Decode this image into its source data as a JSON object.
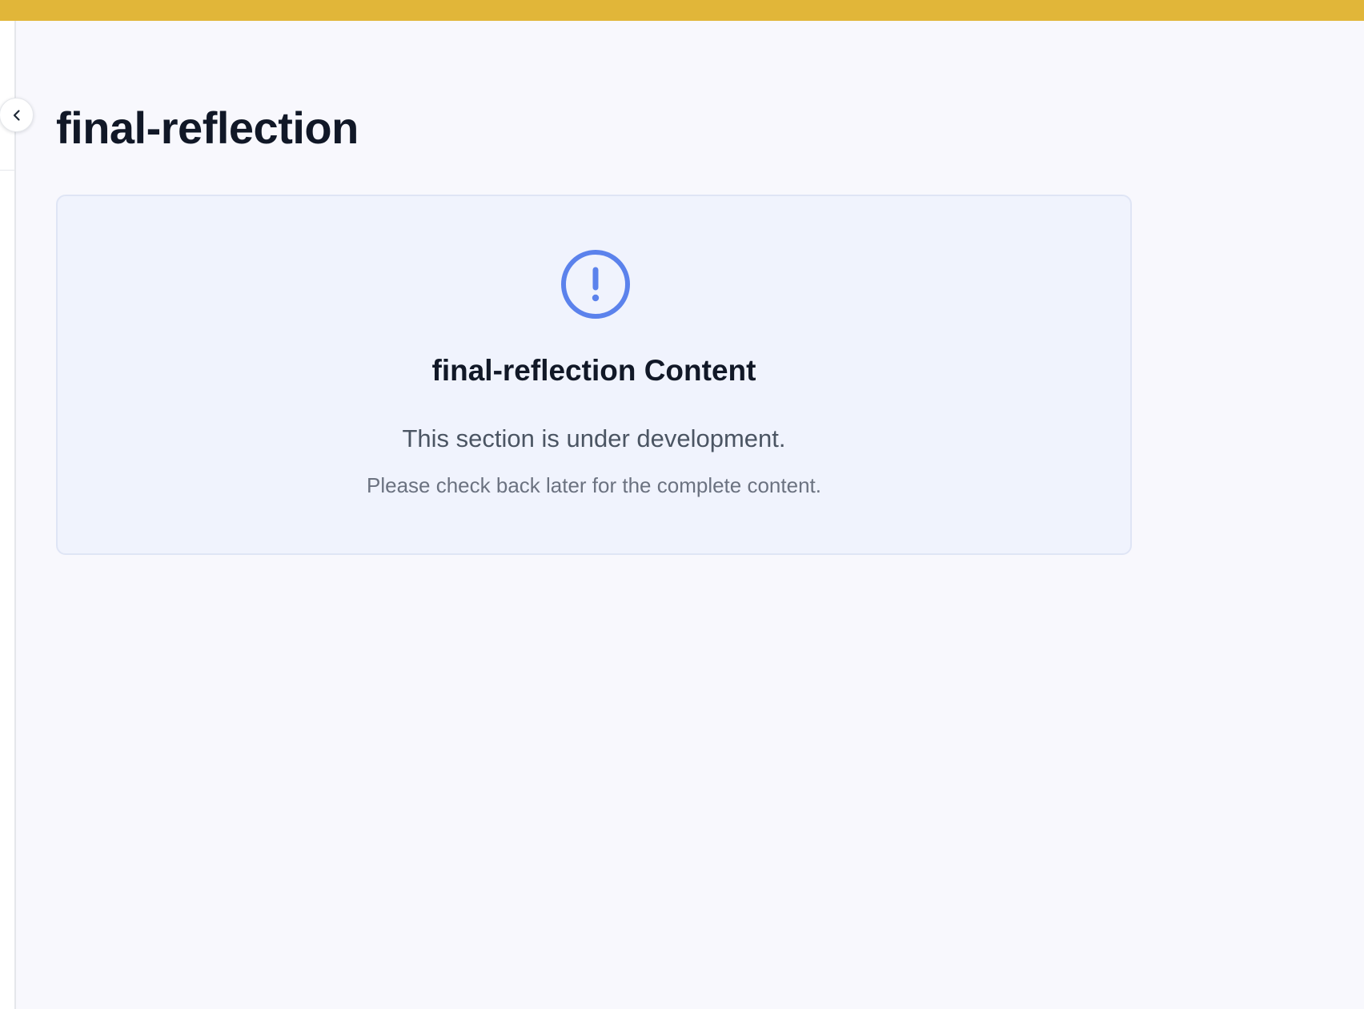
{
  "colors": {
    "top_bar": "#e1b639",
    "background": "#f8f8fd",
    "card_background": "#f0f3fd",
    "card_border": "#dfe5f5",
    "accent": "#5b82ec",
    "title_text": "#111827",
    "body_text": "#4b5563",
    "muted_text": "#6b7280"
  },
  "sidebar": {
    "toggle_icon": "chevron-left-icon"
  },
  "page": {
    "title": "final-reflection"
  },
  "notice": {
    "icon": "exclamation-circle-icon",
    "heading": "final-reflection Content",
    "message": "This section is under development.",
    "submessage": "Please check back later for the complete content."
  }
}
